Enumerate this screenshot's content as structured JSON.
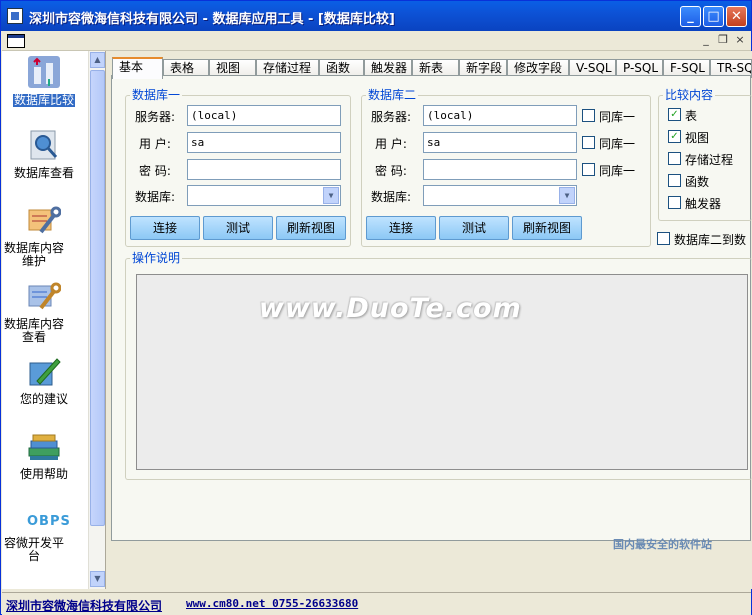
{
  "window": {
    "title": "深圳市容微海信科技有限公司 - 数据库应用工具 - [数据库比较]",
    "controls": {
      "minimize": "_",
      "maximize": "□",
      "close": "✕"
    }
  },
  "mdi_controls": {
    "minimize": "_",
    "restore": "❐",
    "close": "×"
  },
  "sidebar": {
    "items": [
      {
        "label": "数据库比较",
        "icon": "db-compare-icon",
        "active": true
      },
      {
        "label": "数据库查看",
        "icon": "db-view-icon"
      },
      {
        "label": "数据库内容维护",
        "icon": "wrench-icon"
      },
      {
        "label": "数据库内容查看",
        "icon": "tools-icon"
      },
      {
        "label": "您的建议",
        "icon": "pen-icon"
      },
      {
        "label": "使用帮助",
        "icon": "books-icon"
      },
      {
        "label": "容微开发平台",
        "icon": "obps-logo",
        "logo_text": "OBPS"
      }
    ]
  },
  "tabs": [
    "基本",
    "表格",
    "视图",
    "存储过程",
    "函数",
    "触发器",
    "新表",
    "新字段",
    "修改字段",
    "V-SQL",
    "P-SQL",
    "F-SQL",
    "TR-SQL"
  ],
  "db1": {
    "title": "数据库一",
    "server_label": "服务器:",
    "server_value": "(local)",
    "user_label": "用  户:",
    "user_value": "sa",
    "password_label": "密  码:",
    "password_value": "",
    "database_label": "数据库:",
    "database_value": "",
    "btn_connect": "连接",
    "btn_test": "测试",
    "btn_refresh": "刷新视图"
  },
  "db2": {
    "title": "数据库二",
    "server_label": "服务器:",
    "server_value": "(local)",
    "user_label": "用  户:",
    "user_value": "sa",
    "password_label": "密  码:",
    "password_value": "",
    "database_label": "数据库:",
    "database_value": "",
    "same_label": "同库一",
    "btn_connect": "连接",
    "btn_test": "测试",
    "btn_refresh": "刷新视图"
  },
  "compare": {
    "title": "比较内容",
    "items": [
      {
        "label": "表",
        "checked": true
      },
      {
        "label": "视图",
        "checked": true
      },
      {
        "label": "存储过程",
        "checked": false
      },
      {
        "label": "函数",
        "checked": false
      },
      {
        "label": "触发器",
        "checked": false
      }
    ],
    "db2_to_db1": "数据库二到数"
  },
  "operation": {
    "title": "操作说明"
  },
  "statusbar": {
    "company": "深圳市容微海信科技有限公司",
    "contact": "www.cm80.net 0755-26633680"
  },
  "watermark": {
    "main": "www.DuoTe.com",
    "corner": "国内最安全的软件站"
  }
}
